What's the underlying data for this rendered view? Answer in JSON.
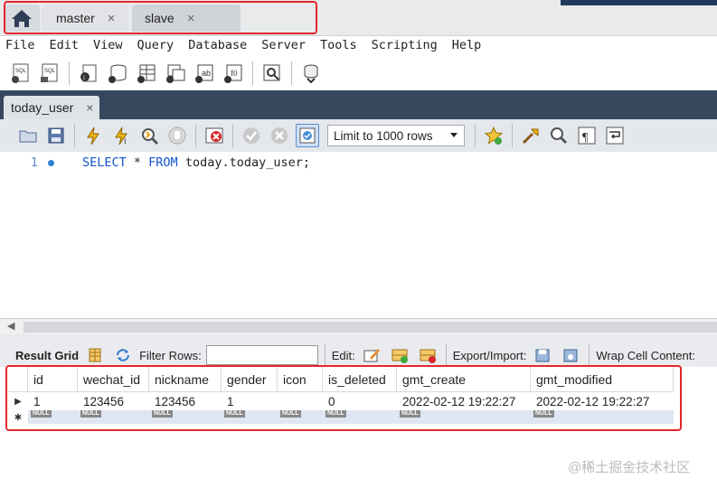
{
  "connection_tabs": [
    {
      "label": "master",
      "close": "×"
    },
    {
      "label": "slave",
      "close": "×"
    }
  ],
  "menu": [
    "File",
    "Edit",
    "View",
    "Query",
    "Database",
    "Server",
    "Tools",
    "Scripting",
    "Help"
  ],
  "editor_tab": {
    "label": "today_user",
    "close": "×"
  },
  "sql_toolbar": {
    "limit_select": "Limit to 1000 rows"
  },
  "editor": {
    "line_number": "1",
    "keyword1": "SELECT",
    "star": " * ",
    "keyword2": "FROM",
    "rest": " today.today_user;"
  },
  "result_toolbar": {
    "result_grid": "Result Grid",
    "filter_rows": "Filter Rows:",
    "edit": "Edit:",
    "export_import": "Export/Import:",
    "wrap": "Wrap Cell Content:"
  },
  "grid": {
    "columns": [
      "id",
      "wechat_id",
      "nickname",
      "gender",
      "icon",
      "is_deleted",
      "gmt_create",
      "gmt_modified"
    ],
    "row": [
      "1",
      "123456",
      "123456",
      "1",
      "",
      "0",
      "2022-02-12 19:22:27",
      "2022-02-12 19:22:27"
    ],
    "null_label": "NULL",
    "row_marker": "▶",
    "new_row_marker": "✱"
  },
  "watermark": "@稀土掘金技术社区",
  "colors": {
    "accent": "#e5262c",
    "editor_tab_bar": "#36485e",
    "keyword": "#1155cc"
  }
}
